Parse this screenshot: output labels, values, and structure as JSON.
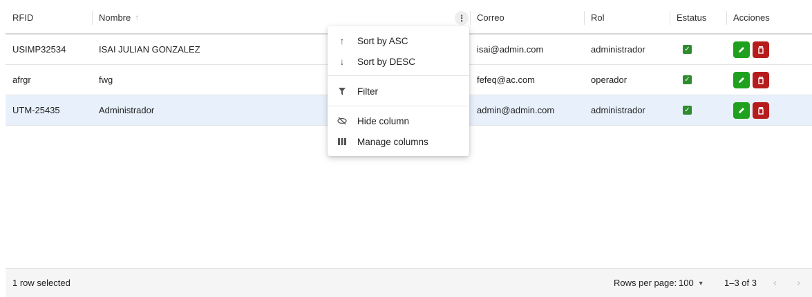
{
  "columns": {
    "rfid": "RFID",
    "nombre": "Nombre",
    "correo": "Correo",
    "rol": "Rol",
    "estatus": "Estatus",
    "acciones": "Acciones"
  },
  "rows": [
    {
      "rfid": "USIMP32534",
      "nombre": "ISAI JULIAN GONZALEZ",
      "correo": "isai@admin.com",
      "rol": "administrador",
      "estatus": true,
      "selected": false
    },
    {
      "rfid": "afrgr",
      "nombre": "fwg",
      "correo": "fefeq@ac.com",
      "rol": "operador",
      "estatus": true,
      "selected": false
    },
    {
      "rfid": "UTM-25435",
      "nombre": "Administrador",
      "correo": "admin@admin.com",
      "rol": "administrador",
      "estatus": true,
      "selected": true
    }
  ],
  "column_menu": {
    "sort_asc": "Sort by ASC",
    "sort_desc": "Sort by DESC",
    "filter": "Filter",
    "hide_column": "Hide column",
    "manage_columns": "Manage columns"
  },
  "footer": {
    "selected_text": "1 row selected",
    "rows_per_page_label": "Rows per page:",
    "rows_per_page_value": "100",
    "page_range": "1–3 of 3"
  },
  "colors": {
    "edit_button": "#1fa11f",
    "delete_button": "#b71c1c",
    "status_check": "#2e8b2e",
    "selected_row": "#e8f0fb"
  },
  "icons": {
    "sort": "arrow-up-icon",
    "column_menu": "kebab-icon",
    "edit": "pencil-icon",
    "delete": "trash-icon",
    "status": "checkbox-checked-icon"
  }
}
